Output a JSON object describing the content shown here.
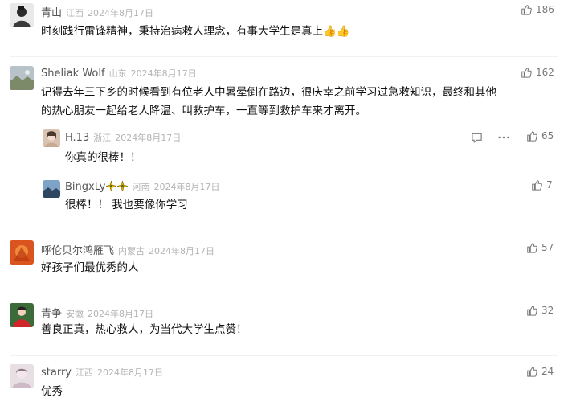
{
  "comments": [
    {
      "name": "青山",
      "location": "江西",
      "date": "2024年8月17日",
      "text": "时刻践行雷锋精神，秉持治病救人理念，有事大学生是真上👍👍",
      "likes": "186",
      "avatar_icon": "avatar-portrait-bw"
    },
    {
      "name": "Sheliak Wolf",
      "location": "山东",
      "date": "2024年8月17日",
      "text_lines": [
        "记得去年三下乡的时候看到有位老人中暑晕倒在路边，很庆幸之前学习过急救知识，最终和其他",
        "的热心朋友一起给老人降温、叫救护车，一直等到救护车来才离开。"
      ],
      "likes": "162",
      "avatar_icon": "avatar-landscape",
      "replies": [
        {
          "name": "H.13",
          "location": "浙江",
          "date": "2024年8月17日",
          "text": "你真的很棒！！",
          "likes": "65",
          "avatar_icon": "avatar-portrait",
          "actions": [
            "reply-icon",
            "more-icon"
          ]
        },
        {
          "name": "BingxLy",
          "name_badges": [
            "sparkle-badge-icon",
            "sparkle-badge-icon"
          ],
          "location": "河南",
          "date": "2024年8月17日",
          "text": "很棒！！ 我也要像你学习",
          "likes": "7",
          "avatar_icon": "avatar-sky"
        }
      ]
    },
    {
      "name": "呼伦贝尔鸿雁飞",
      "location": "内蒙古",
      "date": "2024年8月17日",
      "text": "好孩子们最优秀的人",
      "likes": "57",
      "avatar_icon": "avatar-orange"
    },
    {
      "name": "青争",
      "location": "安徽",
      "date": "2024年8月17日",
      "text": "善良正真，热心救人，为当代大学生点赞！",
      "likes": "32",
      "avatar_icon": "avatar-red"
    },
    {
      "name": "starry",
      "location": "江西",
      "date": "2024年8月17日",
      "text": "优秀",
      "likes": "24",
      "avatar_icon": "avatar-soft"
    }
  ]
}
